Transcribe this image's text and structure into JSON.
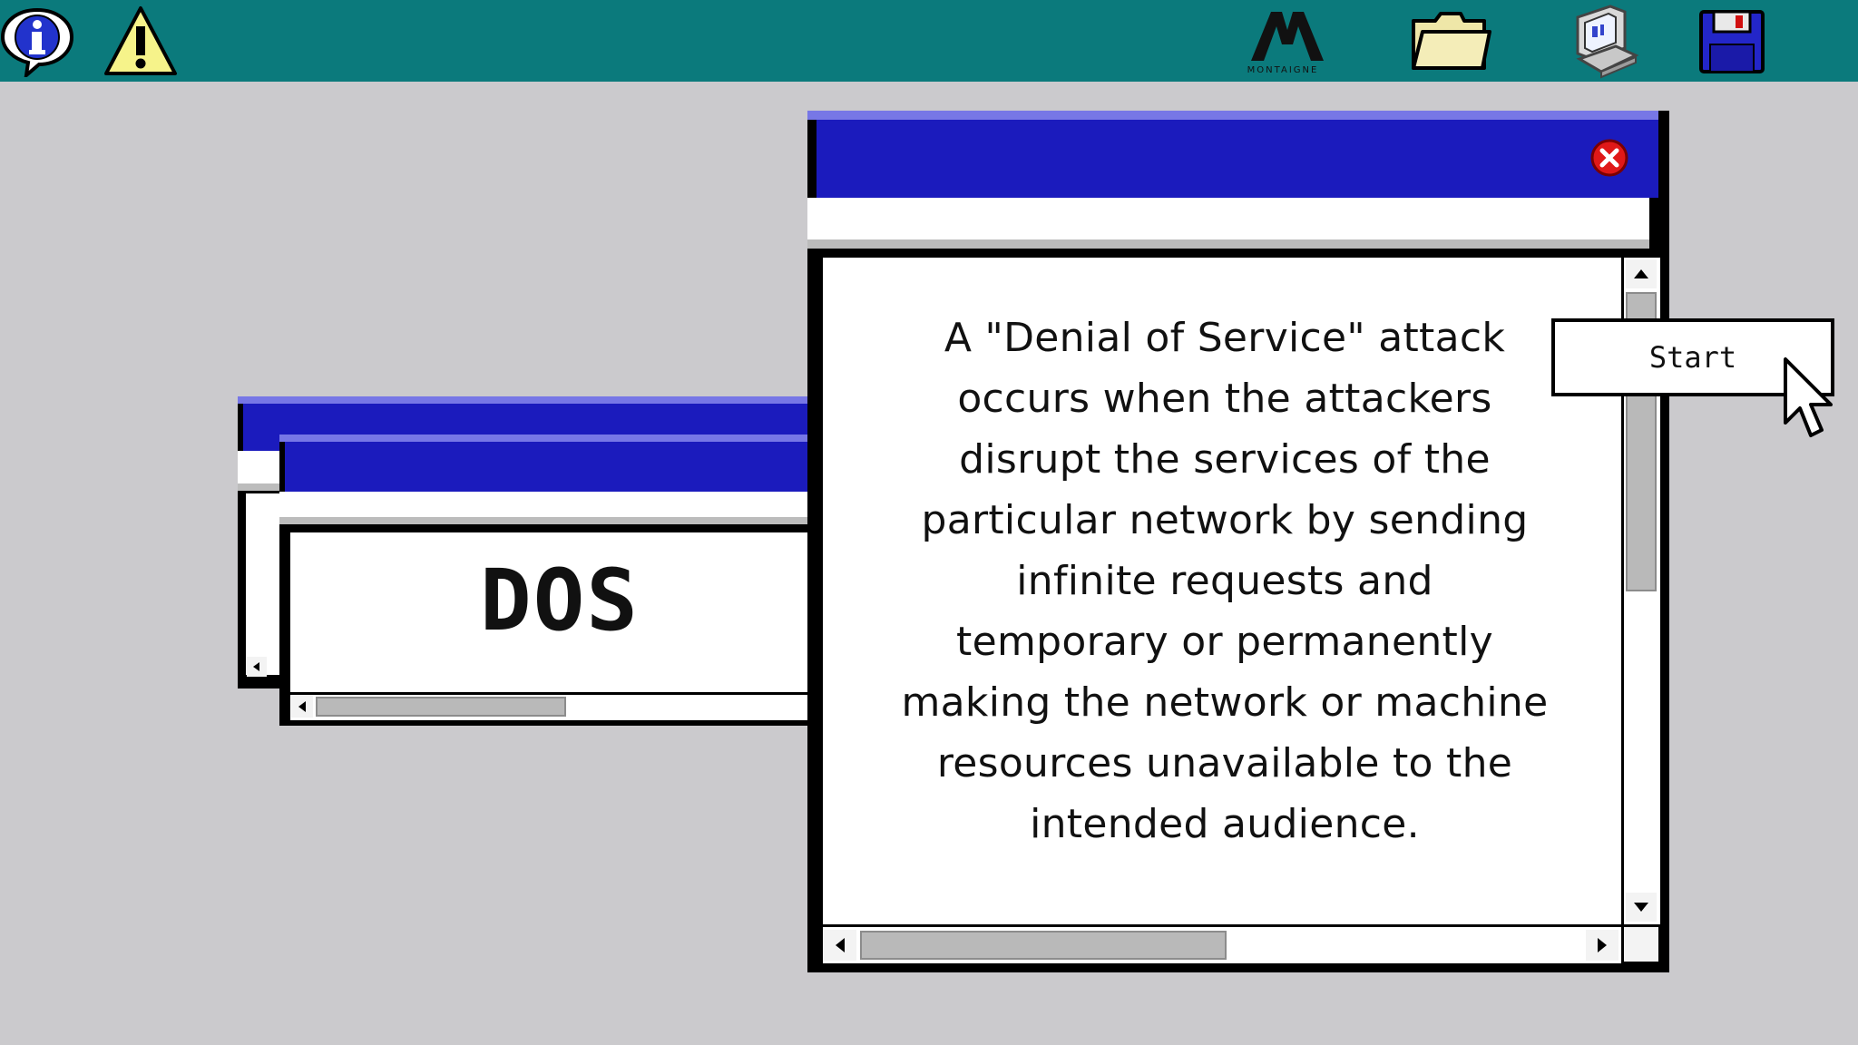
{
  "topbar": {
    "icons": [
      {
        "name": "info-icon"
      },
      {
        "name": "warning-icon"
      },
      {
        "name": "montaigne-logo",
        "brand_text": "MONTAIGNE"
      },
      {
        "name": "folder-icon"
      },
      {
        "name": "computer-icon"
      },
      {
        "name": "floppy-disk-icon"
      }
    ]
  },
  "main_window": {
    "body_lines": [
      "A \"Denial of Service\" attack",
      "occurs when the attackers",
      "disrupt the services of the",
      "particular network by sending",
      "infinite requests and",
      "temporary or permanently",
      "making the network or machine",
      "resources unavailable to the",
      "intended audience."
    ],
    "close_icon": "close-icon"
  },
  "dos_window": {
    "title_text": "DOS"
  },
  "start_button": {
    "label": "Start"
  },
  "colors": {
    "desktop": "#cbcacd",
    "topbar": "#0b7a7c",
    "titlebar": "#1b1bbd",
    "close_red": "#e01818"
  }
}
